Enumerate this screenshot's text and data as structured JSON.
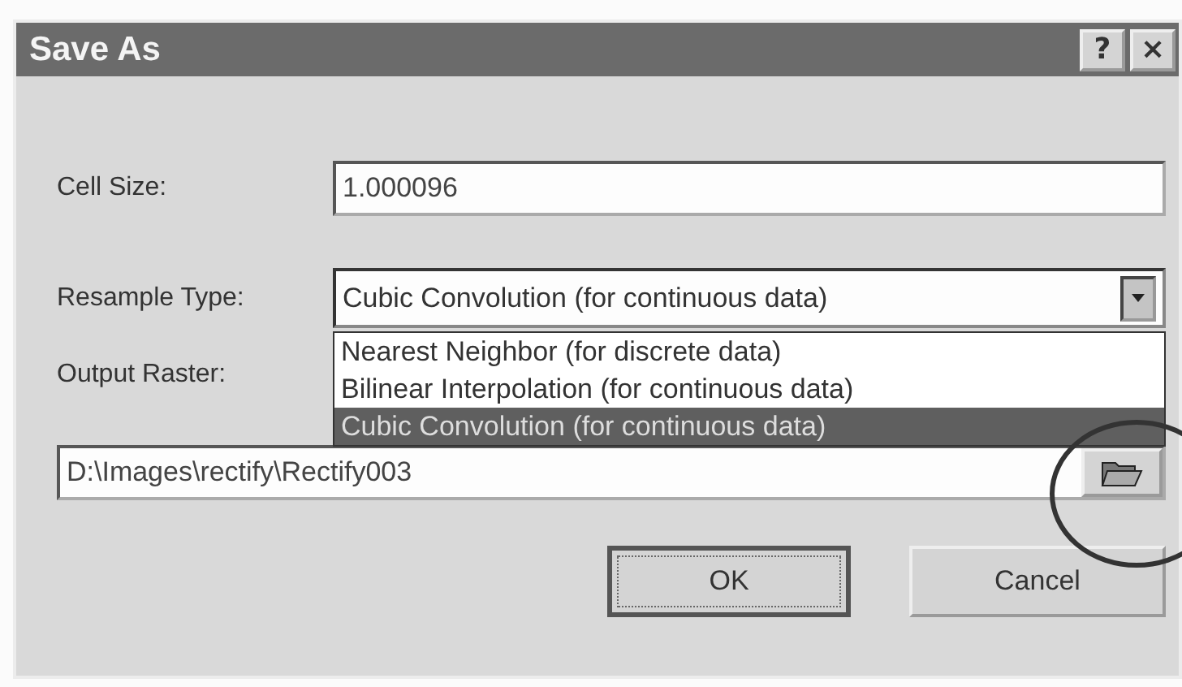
{
  "window": {
    "title": "Save As",
    "title_buttons": [
      "?",
      "×"
    ]
  },
  "cell_size": {
    "label": "Cell Size:",
    "value": "1.000096"
  },
  "resample_type": {
    "label": "Resample Type:",
    "value": "Cubic Convolution (for continuous data)",
    "expanded": true,
    "options": [
      {
        "label": "Nearest Neighbor (for discrete data)",
        "selected": false
      },
      {
        "label": "Bilinear Interpolation (for continuous data)",
        "selected": false
      },
      {
        "label": "Cubic Convolution (for continuous data)",
        "selected": true
      }
    ]
  },
  "output_raster": {
    "label": "Output Raster:",
    "value": "D:\\Images\\rectify\\Rectify003"
  },
  "buttons": [
    {
      "label": "OK",
      "kind": "default"
    },
    {
      "label": "Cancel",
      "kind": "normal"
    }
  ]
}
